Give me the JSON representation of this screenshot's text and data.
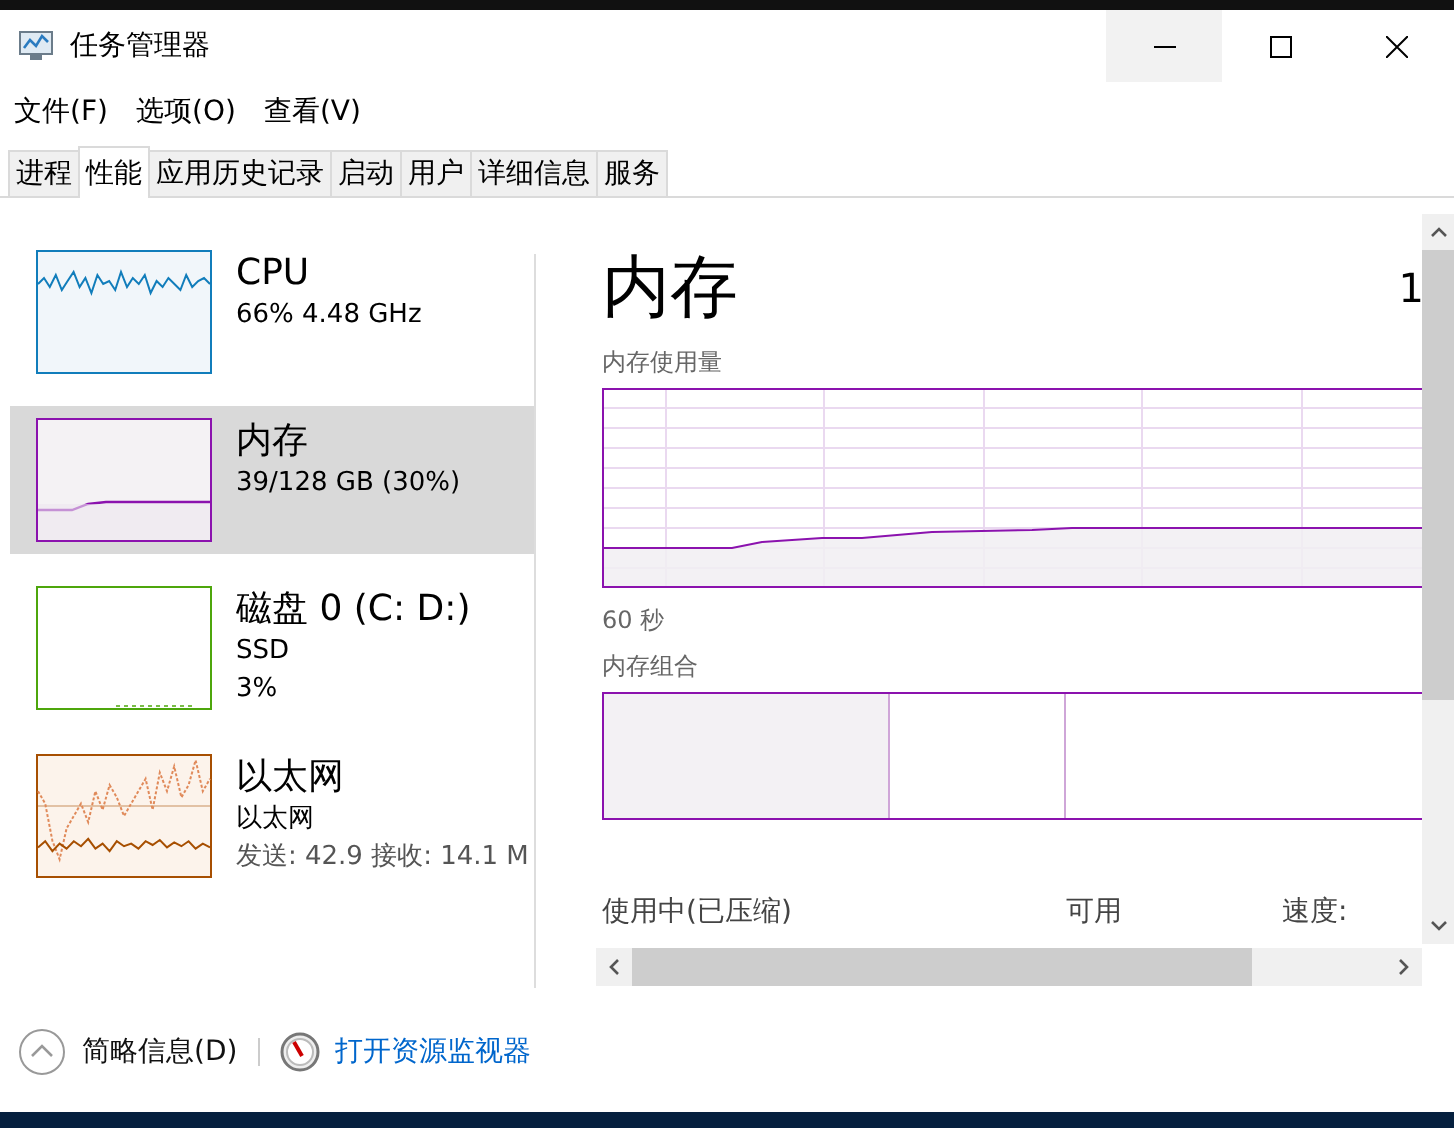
{
  "window": {
    "title": "任务管理器"
  },
  "menu": [
    "文件(F)",
    "选项(O)",
    "查看(V)"
  ],
  "tabs": [
    {
      "label": "进程",
      "selected": false
    },
    {
      "label": "性能",
      "selected": true
    },
    {
      "label": "应用历史记录",
      "selected": false
    },
    {
      "label": "启动",
      "selected": false
    },
    {
      "label": "用户",
      "selected": false
    },
    {
      "label": "详细信息",
      "selected": false
    },
    {
      "label": "服务",
      "selected": false
    }
  ],
  "sidebar": {
    "items": [
      {
        "kind": "cpu",
        "title": "CPU",
        "lines": [
          "66% 4.48 GHz"
        ],
        "selected": false,
        "color": "#117dbb"
      },
      {
        "kind": "memory",
        "title": "内存",
        "lines": [
          "39/128 GB (30%)"
        ],
        "selected": true,
        "color": "#8b12ae"
      },
      {
        "kind": "disk",
        "title": "磁盘 0 (C: D:)",
        "lines": [
          "SSD",
          "3%"
        ],
        "selected": false,
        "color": "#4da60c"
      },
      {
        "kind": "network",
        "title": "以太网",
        "lines": [
          "以太网",
          "发送: 42.9 接收: 14.1 M"
        ],
        "selected": false,
        "color": "#a74f01"
      }
    ]
  },
  "detail": {
    "title": "内存",
    "total_cut": "1",
    "usage_label": "内存使用量",
    "time_label": "60 秒",
    "composition_label": "内存组合",
    "composition": {
      "in_use": {
        "level": 0.345
      }
    },
    "stats": [
      "使用中(已压缩)",
      "可用",
      "速度:"
    ]
  },
  "footer": {
    "fewer_details": "简略信息(D)",
    "resource_monitor": "打开资源监视器"
  }
}
